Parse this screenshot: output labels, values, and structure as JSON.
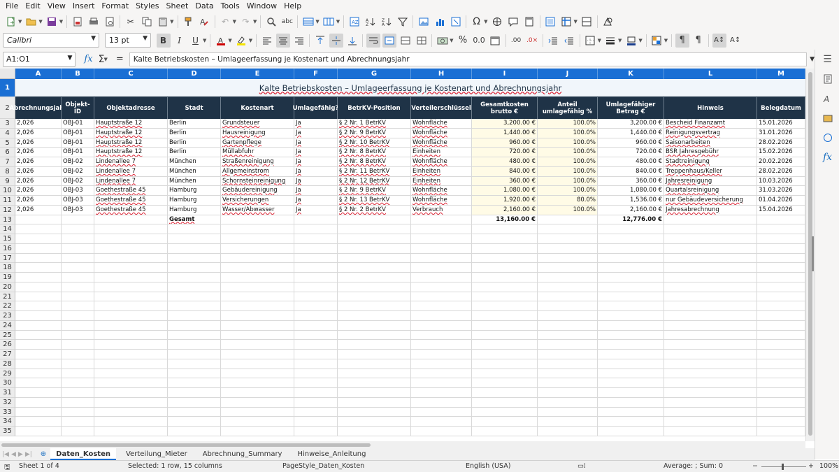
{
  "menubar": [
    "File",
    "Edit",
    "View",
    "Insert",
    "Format",
    "Styles",
    "Sheet",
    "Data",
    "Tools",
    "Window",
    "Help"
  ],
  "toolbar": {
    "font_name": "Calibri",
    "font_size": "13 pt"
  },
  "formula_bar": {
    "cell_ref": "A1:O1",
    "fx_label": "fx",
    "sum_label": "Σ",
    "eq_label": "=",
    "content": "Kalte Betriebskosten – Umlageerfassung je Kostenart und Abrechnungsjahr"
  },
  "columns": [
    "A",
    "B",
    "C",
    "D",
    "E",
    "F",
    "G",
    "H",
    "I",
    "J",
    "K",
    "L",
    "M"
  ],
  "row_numbers": [
    "1",
    "2",
    "3",
    "4",
    "5",
    "6",
    "7",
    "8",
    "9",
    "10",
    "11",
    "12",
    "13",
    "14",
    "15",
    "16",
    "17",
    "18",
    "19",
    "20",
    "21",
    "22",
    "23",
    "24",
    "25",
    "26",
    "27",
    "28",
    "29",
    "30",
    "31",
    "32",
    "33",
    "34",
    "35"
  ],
  "sheet_title": "Kalte Betriebskosten – Umlageerfassung je Kostenart und Abrechnungsjahr",
  "headers": [
    "Abrechnungsjahr",
    "Objekt-ID",
    "Objektadresse",
    "Stadt",
    "Kostenart",
    "Umlagefähig?",
    "BetrKV-Position",
    "Verteilerschlüssel",
    "Gesamtkosten brutto €",
    "Anteil umlagefähig %",
    "Umlagefähiger Betrag €",
    "Hinweis",
    "Belegdatum"
  ],
  "rows": [
    [
      "2,026",
      "OBJ-01",
      "Hauptstraße 12",
      "Berlin",
      "Grundsteuer",
      "Ja",
      "§ 2 Nr. 1 BetrKV",
      "Wohnfläche",
      "3,200.00 €",
      "100.0%",
      "3,200.00 €",
      "Bescheid Finanzamt",
      "15.01.2026"
    ],
    [
      "2,026",
      "OBJ-01",
      "Hauptstraße 12",
      "Berlin",
      "Hausreinigung",
      "Ja",
      "§ 2 Nr. 9 BetrKV",
      "Wohnfläche",
      "1,440.00 €",
      "100.0%",
      "1,440.00 €",
      "Reinigungsvertrag",
      "31.01.2026"
    ],
    [
      "2,026",
      "OBJ-01",
      "Hauptstraße 12",
      "Berlin",
      "Gartenpflege",
      "Ja",
      "§ 2 Nr. 10 BetrKV",
      "Wohnfläche",
      "960.00 €",
      "100.0%",
      "960.00 €",
      "Saisonarbeiten",
      "28.02.2026"
    ],
    [
      "2,026",
      "OBJ-01",
      "Hauptstraße 12",
      "Berlin",
      "Müllabfuhr",
      "Ja",
      "§ 2 Nr. 8 BetrKV",
      "Einheiten",
      "720.00 €",
      "100.0%",
      "720.00 €",
      "BSR Jahresgebühr",
      "15.02.2026"
    ],
    [
      "2,026",
      "OBJ-02",
      "Lindenallee 7",
      "München",
      "Straßenreinigung",
      "Ja",
      "§ 2 Nr. 8 BetrKV",
      "Wohnfläche",
      "480.00 €",
      "100.0%",
      "480.00 €",
      "Stadtreinigung",
      "20.02.2026"
    ],
    [
      "2,026",
      "OBJ-02",
      "Lindenallee 7",
      "München",
      "Allgemeinstrom",
      "Ja",
      "§ 2 Nr. 11 BetrKV",
      "Einheiten",
      "840.00 €",
      "100.0%",
      "840.00 €",
      "Treppenhaus/Keller",
      "28.02.2026"
    ],
    [
      "2,026",
      "OBJ-02",
      "Lindenallee 7",
      "München",
      "Schornsteinreinigung",
      "Ja",
      "§ 2 Nr. 12 BetrKV",
      "Einheiten",
      "360.00 €",
      "100.0%",
      "360.00 €",
      "Jahresreinigung",
      "10.03.2026"
    ],
    [
      "2,026",
      "OBJ-03",
      "Goethestraße 45",
      "Hamburg",
      "Gebäudereinigung",
      "Ja",
      "§ 2 Nr. 9 BetrKV",
      "Wohnfläche",
      "1,080.00 €",
      "100.0%",
      "1,080.00 €",
      "Quartalsreinigung",
      "31.03.2026"
    ],
    [
      "2,026",
      "OBJ-03",
      "Goethestraße 45",
      "Hamburg",
      "Versicherungen",
      "Ja",
      "§ 2 Nr. 13 BetrKV",
      "Wohnfläche",
      "1,920.00 €",
      "80.0%",
      "1,536.00 €",
      "nur Gebäudeversicherung",
      "01.04.2026"
    ],
    [
      "2,026",
      "OBJ-03",
      "Goethestraße 45",
      "Hamburg",
      "Wasser/Abwasser",
      "Ja",
      "§ 2 Nr. 2 BetrKV",
      "Verbrauch",
      "2,160.00 €",
      "100.0%",
      "2,160.00 €",
      "Jahresabrechnung",
      "15.04.2026"
    ]
  ],
  "totals": {
    "label": "Gesamt",
    "gesamtkosten": "13,160.00 €",
    "umlagefaehig": "12,776.00 €"
  },
  "tabs": [
    "Daten_Kosten",
    "Verteilung_Mieter",
    "Abrechnung_Summary",
    "Hinweise_Anleitung"
  ],
  "status": {
    "sheet": "Sheet 1 of 4",
    "selection": "Selected: 1 row, 15 columns",
    "page_style": "PageStyle_Daten_Kosten",
    "language": "English (USA)",
    "summary": "Average: ; Sum: 0",
    "zoom": "100%"
  },
  "colors": {
    "header_bg": "#1f3347",
    "colhead_bg": "#1a6fd4",
    "title_bg": "#f1f6fb",
    "highlight_col": "#fffbe6"
  }
}
